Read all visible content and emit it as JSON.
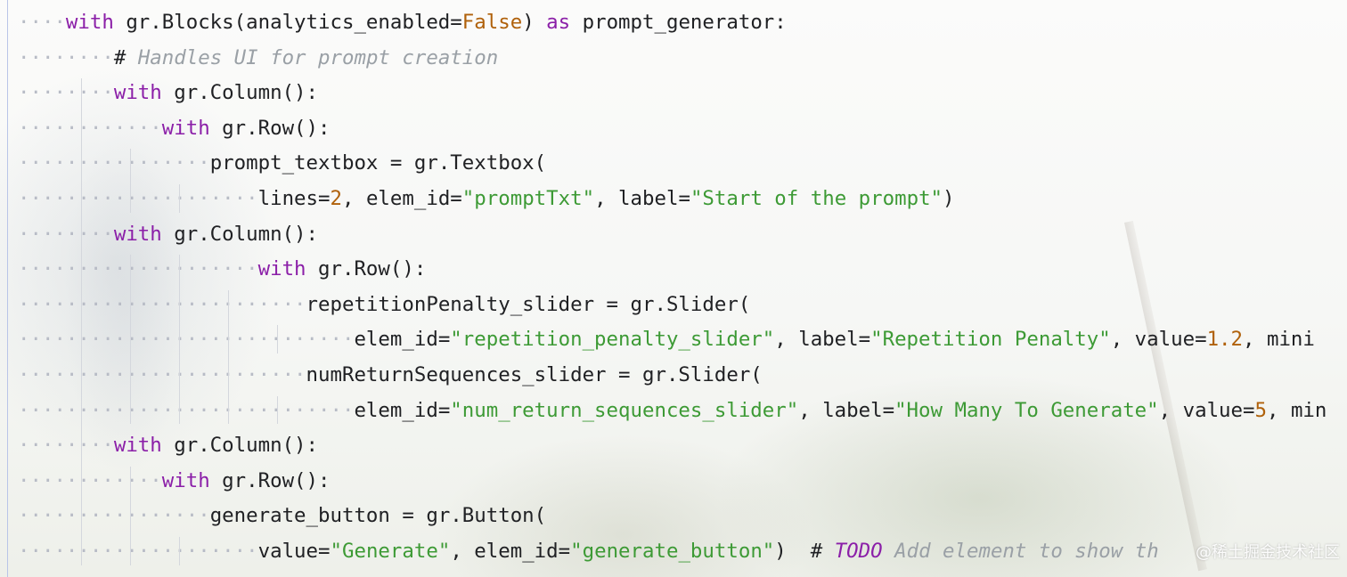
{
  "editor": {
    "language": "python",
    "lines": [
      {
        "indent": 1,
        "tokens": [
          {
            "t": "kw",
            "v": "with"
          },
          {
            "t": "plain",
            "v": " gr.Blocks(analytics_enabled="
          },
          {
            "t": "num",
            "v": "False"
          },
          {
            "t": "plain",
            "v": ") "
          },
          {
            "t": "kw",
            "v": "as"
          },
          {
            "t": "plain",
            "v": " prompt_generator:"
          }
        ]
      },
      {
        "indent": 2,
        "tokens": [
          {
            "t": "plain",
            "v": "# "
          },
          {
            "t": "cm",
            "v": "Handles UI for prompt creation"
          }
        ]
      },
      {
        "indent": 2,
        "tokens": [
          {
            "t": "kw",
            "v": "with"
          },
          {
            "t": "plain",
            "v": " gr.Column():"
          }
        ]
      },
      {
        "indent": 3,
        "tokens": [
          {
            "t": "kw",
            "v": "with"
          },
          {
            "t": "plain",
            "v": " gr.Row():"
          }
        ]
      },
      {
        "indent": 4,
        "tokens": [
          {
            "t": "plain",
            "v": "prompt_textbox = gr.Textbox("
          }
        ]
      },
      {
        "indent": 5,
        "tokens": [
          {
            "t": "plain",
            "v": "lines="
          },
          {
            "t": "num",
            "v": "2"
          },
          {
            "t": "plain",
            "v": ", elem_id="
          },
          {
            "t": "str",
            "v": "\"promptTxt\""
          },
          {
            "t": "plain",
            "v": ", label="
          },
          {
            "t": "str",
            "v": "\"Start of the prompt\""
          },
          {
            "t": "plain",
            "v": ")"
          }
        ]
      },
      {
        "indent": 2,
        "tokens": [
          {
            "t": "kw",
            "v": "with"
          },
          {
            "t": "plain",
            "v": " gr.Column():"
          }
        ]
      },
      {
        "indent": 5,
        "tokens": [
          {
            "t": "kw",
            "v": "with"
          },
          {
            "t": "plain",
            "v": " gr.Row():"
          }
        ]
      },
      {
        "indent": 6,
        "tokens": [
          {
            "t": "plain",
            "v": "repetitionPenalty_slider = gr.Slider("
          }
        ]
      },
      {
        "indent": 7,
        "tokens": [
          {
            "t": "plain",
            "v": "elem_id="
          },
          {
            "t": "str",
            "v": "\"repetition_penalty_slider\""
          },
          {
            "t": "plain",
            "v": ", label="
          },
          {
            "t": "str",
            "v": "\"Repetition Penalty\""
          },
          {
            "t": "plain",
            "v": ", value="
          },
          {
            "t": "num",
            "v": "1.2"
          },
          {
            "t": "plain",
            "v": ", mini"
          }
        ]
      },
      {
        "indent": 6,
        "tokens": [
          {
            "t": "plain",
            "v": "numReturnSequences_slider = gr.Slider("
          }
        ]
      },
      {
        "indent": 7,
        "tokens": [
          {
            "t": "plain",
            "v": "elem_id="
          },
          {
            "t": "str",
            "v": "\"num_return_sequences_slider\""
          },
          {
            "t": "plain",
            "v": ", label="
          },
          {
            "t": "str",
            "v": "\"How Many To Generate\""
          },
          {
            "t": "plain",
            "v": ", value="
          },
          {
            "t": "num",
            "v": "5"
          },
          {
            "t": "plain",
            "v": ", min"
          }
        ]
      },
      {
        "indent": 2,
        "tokens": [
          {
            "t": "kw",
            "v": "with"
          },
          {
            "t": "plain",
            "v": " gr.Column():"
          }
        ]
      },
      {
        "indent": 3,
        "tokens": [
          {
            "t": "kw",
            "v": "with"
          },
          {
            "t": "plain",
            "v": " gr.Row():"
          }
        ]
      },
      {
        "indent": 4,
        "tokens": [
          {
            "t": "plain",
            "v": "generate_button = gr.Button("
          }
        ]
      },
      {
        "indent": 5,
        "tokens": [
          {
            "t": "plain",
            "v": "value="
          },
          {
            "t": "str",
            "v": "\"Generate\""
          },
          {
            "t": "plain",
            "v": ", elem_id="
          },
          {
            "t": "str",
            "v": "\"generate_button\""
          },
          {
            "t": "plain",
            "v": ")  # "
          },
          {
            "t": "todo",
            "v": "TODO"
          },
          {
            "t": "cm",
            "v": " Add element to show th"
          }
        ]
      }
    ]
  },
  "watermark": "@稀土掘金技术社区",
  "colors": {
    "keyword": "#8b1fa8",
    "string": "#3d9a35",
    "number": "#b0610b",
    "comment": "#9aa0a6",
    "whitespace_dot": "#b8bcc6"
  }
}
